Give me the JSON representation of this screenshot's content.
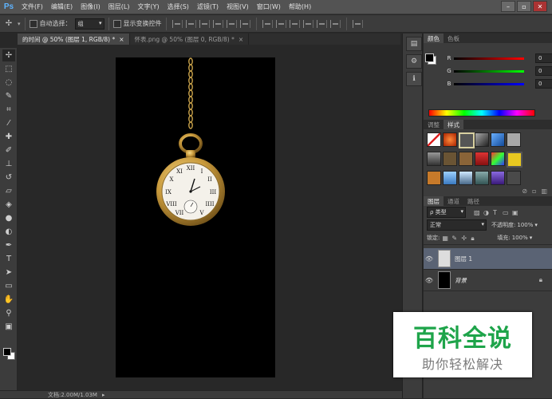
{
  "app": {
    "logo": "Ps"
  },
  "menu": [
    "文件(F)",
    "编辑(E)",
    "图像(I)",
    "图层(L)",
    "文字(Y)",
    "选择(S)",
    "滤镜(T)",
    "视图(V)",
    "窗口(W)",
    "帮助(H)"
  ],
  "window_controls": {
    "minimize": "–",
    "restore": "▫",
    "close": "✕"
  },
  "options": {
    "auto_select_label": "自动选择：",
    "auto_select_value": "组",
    "show_transform_label": "显示变换控件"
  },
  "tabs": [
    {
      "label": "的时间 @ 50% (图层 1, RGB/8) *",
      "close": "×"
    },
    {
      "label": "怀表.png @ 50% (图层 0, RGB/8) *",
      "close": "×"
    }
  ],
  "tools": [
    "move-tool",
    "marquee-tool",
    "lasso-tool",
    "quick-select-tool",
    "crop-tool",
    "eyedropper-tool",
    "healing-tool",
    "brush-tool",
    "stamp-tool",
    "history-brush-tool",
    "eraser-tool",
    "bucket-tool",
    "blur-tool",
    "dodge-tool",
    "pen-tool",
    "type-tool",
    "path-select-tool",
    "shape-tool",
    "hand-tool",
    "zoom-tool"
  ],
  "status": {
    "doc_size": "文档:2.00M/1.03M"
  },
  "color_panel": {
    "tabs": [
      "颜色",
      "色板"
    ],
    "channels": [
      {
        "label": "R",
        "value": "0",
        "color": "#e03030"
      },
      {
        "label": "G",
        "value": "0",
        "color": "#30c030"
      },
      {
        "label": "B",
        "value": "0",
        "color": "#3040e0"
      }
    ]
  },
  "styles_panel": {
    "tabs": [
      "调整",
      "样式"
    ]
  },
  "layers_panel": {
    "tabs": [
      "图层",
      "通道",
      "路径"
    ],
    "filter_kind": "ρ 类型",
    "blend_mode": "正常",
    "opacity_label": "不透明度:",
    "opacity_value": "100%",
    "lock_label": "锁定:",
    "fill_label": "填充:",
    "fill_value": "100%",
    "layers": [
      {
        "name": "图层 1",
        "selected": true
      },
      {
        "name": "背景",
        "selected": false
      }
    ]
  },
  "watermark": {
    "title": "百科全说",
    "subtitle": "助你轻松解决"
  },
  "colors": {
    "accent_green": "#1ea44a",
    "selected_layer": "#5a6374",
    "menubar": "#535353"
  }
}
